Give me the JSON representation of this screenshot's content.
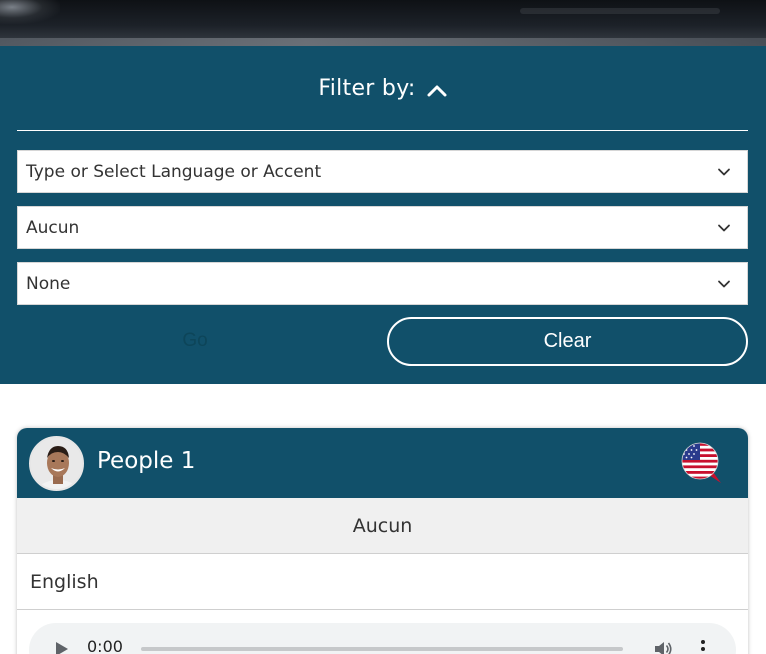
{
  "filter": {
    "title": "Filter by:",
    "language_select": {
      "value": "Type or Select Language or Accent"
    },
    "level_select": {
      "value": "Aucun"
    },
    "third_select": {
      "value": "None"
    },
    "go_label": "Go",
    "clear_label": "Clear"
  },
  "card": {
    "name": "People 1",
    "level": "Aucun",
    "language": "English",
    "audio": {
      "time": "0:00"
    },
    "flag_icon": "us-flag-speech-bubble-icon"
  },
  "colors": {
    "panel": "#11506a",
    "white": "#ffffff",
    "row_gray": "#f0f0f0"
  }
}
